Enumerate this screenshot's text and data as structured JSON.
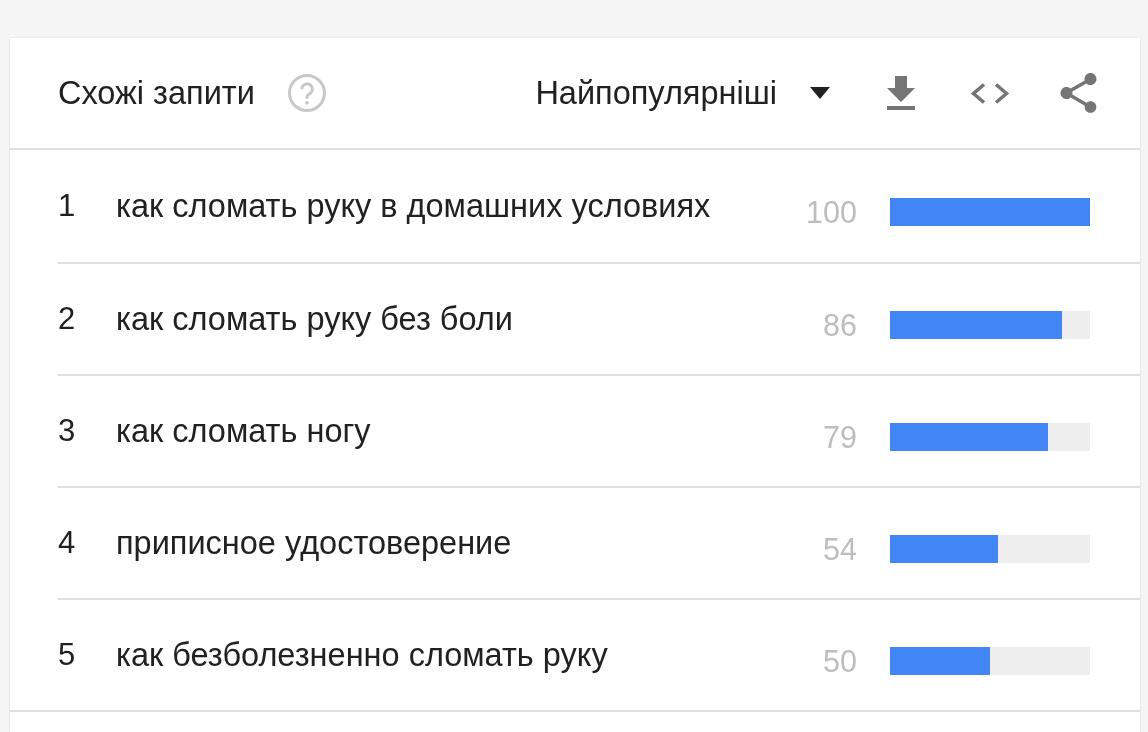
{
  "panel": {
    "title": "Схожі запити",
    "sort": {
      "label": "Найпопулярніші"
    }
  },
  "queries": [
    {
      "rank": "1",
      "text": "как сломать руку в домашних условиях",
      "value": "100",
      "level": 1.0
    },
    {
      "rank": "2",
      "text": "как сломать руку без боли",
      "value": "86",
      "level": 0.86
    },
    {
      "rank": "3",
      "text": "как сломать ногу",
      "value": "79",
      "level": 0.79
    },
    {
      "rank": "4",
      "text": "приписное удостоверение",
      "value": "54",
      "level": 0.54
    },
    {
      "rank": "5",
      "text": "как безболезненно сломать руку",
      "value": "50",
      "level": 0.5
    }
  ]
}
